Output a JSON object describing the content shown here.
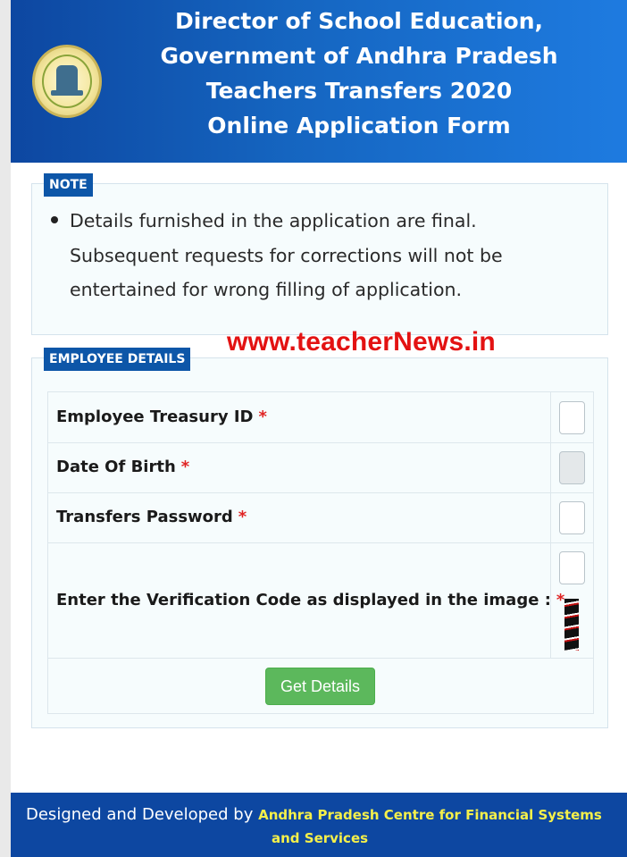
{
  "header": {
    "title_lines": [
      "Director of School Education,",
      "Government of Andhra Pradesh",
      "Teachers Transfers 2020",
      "Online Application Form"
    ],
    "logo_icon": "andhra-pradesh-emblem-icon"
  },
  "note": {
    "legend": "NOTE",
    "lines": [
      "Details furnished in the application are final.",
      "Subsequent requests for corrections will not be",
      "entertained for wrong filling of application."
    ]
  },
  "watermark": "www.teacherNews.in",
  "employee": {
    "legend": "EMPLOYEE DETAILS",
    "required_mark": "*",
    "fields": [
      {
        "label": "Employee Treasury ID",
        "value": "",
        "disabled": false
      },
      {
        "label": "Date Of Birth",
        "value": "",
        "disabled": true
      },
      {
        "label": "Transfers Password",
        "value": "",
        "disabled": false
      },
      {
        "label": "Enter the Verification Code as displayed in the image :",
        "value": "",
        "disabled": false
      }
    ],
    "button_label": "Get Details"
  },
  "footer": {
    "prefix": "Designed and Developed by",
    "org_line1": "Andhra Pradesh Centre for Financial Systems",
    "org_line2": "and Services"
  },
  "colors": {
    "header_blue": "#0d47a1",
    "legend_blue": "#0d56a8",
    "button_green": "#5cb85c",
    "required_red": "#e02424",
    "watermark_red": "#e31212",
    "footer_org_yellow": "#f5f04a"
  }
}
